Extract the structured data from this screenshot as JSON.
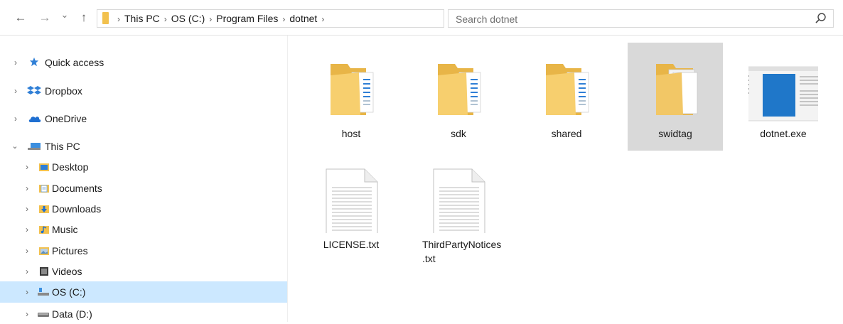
{
  "toolbar": {
    "back_glyph": "←",
    "forward_glyph": "→",
    "recent_glyph": "⌄",
    "up_glyph": "↑",
    "breadcrumbs": [
      "This PC",
      "OS (C:)",
      "Program Files",
      "dotnet"
    ],
    "separator": "›",
    "dropdown_glyph": "⌄",
    "refresh_glyph": "↻",
    "search_placeholder": "Search dotnet"
  },
  "nav_pane": {
    "items": [
      {
        "label": "Quick access",
        "icon": "star-icon",
        "expanded": false
      },
      {
        "label": "Dropbox",
        "icon": "dropbox-icon",
        "expanded": false
      },
      {
        "label": "OneDrive",
        "icon": "cloud-icon",
        "expanded": false
      },
      {
        "label": "This PC",
        "icon": "computer-icon",
        "expanded": true
      },
      {
        "label": "Desktop",
        "icon": "desktop-folder-icon",
        "expanded": false
      },
      {
        "label": "Documents",
        "icon": "documents-folder-icon",
        "expanded": false
      },
      {
        "label": "Downloads",
        "icon": "downloads-folder-icon",
        "expanded": false
      },
      {
        "label": "Music",
        "icon": "music-folder-icon",
        "expanded": false
      },
      {
        "label": "Pictures",
        "icon": "pictures-folder-icon",
        "expanded": false
      },
      {
        "label": "Videos",
        "icon": "videos-folder-icon",
        "expanded": false
      },
      {
        "label": "OS (C:)",
        "icon": "drive-icon",
        "expanded": false,
        "selected": true
      },
      {
        "label": "Data (D:)",
        "icon": "drive-icon",
        "expanded": false
      }
    ]
  },
  "content": {
    "items": [
      {
        "label": "host",
        "type": "folder",
        "icon": "folder-icon"
      },
      {
        "label": "sdk",
        "type": "folder",
        "icon": "folder-icon"
      },
      {
        "label": "shared",
        "type": "folder",
        "icon": "folder-icon"
      },
      {
        "label": "swidtag",
        "type": "folder",
        "icon": "folder-icon",
        "selected": true
      },
      {
        "label": "dotnet.exe",
        "type": "application",
        "icon": "application-icon"
      },
      {
        "label": "LICENSE.txt",
        "type": "text",
        "icon": "text-file-icon"
      },
      {
        "label": "ThirdPartyNotices.txt",
        "type": "text",
        "icon": "text-file-icon"
      }
    ]
  },
  "colors": {
    "selection_nav": "#cce8ff",
    "selection_tile": "#d9d9d9",
    "folder": "#f2c14e",
    "exe_blue": "#1f77c9"
  }
}
